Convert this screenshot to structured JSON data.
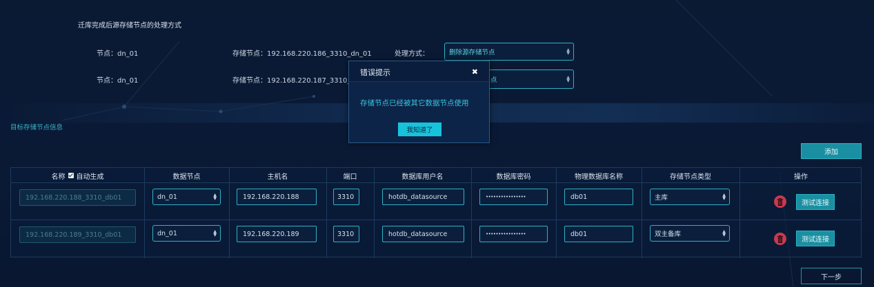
{
  "section_title": "迁库完成后源存储节点的处理方式",
  "process_rows": [
    {
      "node": "节点：dn_01",
      "storage": "存储节点：192.168.220.186_3310_dn_01",
      "method_label": "处理方式：",
      "method_value": "删除源存储节点"
    },
    {
      "node": "节点：dn_01",
      "storage": "存储节点：192.168.220.187_3310_dn_0",
      "method_value": "点"
    }
  ],
  "target_title": "目标存储节点信息",
  "add_button": "添加",
  "table": {
    "headers": {
      "name": "名称",
      "auto_generate": "自动生成",
      "data_node": "数据节点",
      "host": "主机名",
      "port": "端口",
      "db_user": "数据库用户名",
      "db_password": "数据库密码",
      "physical_db": "物理数据库名称",
      "node_type": "存储节点类型",
      "actions": "操作"
    },
    "rows": [
      {
        "name": "192.168.220.188_3310_db01",
        "data_node": "dn_01",
        "host": "192.168.220.188",
        "port": "3310",
        "db_user": "hotdb_datasource",
        "db_password": "••••••••••••••••",
        "physical_db": "db01",
        "node_type": "主库",
        "test_button": "测试连接"
      },
      {
        "name": "192.168.220.189_3310_db01",
        "data_node": "dn_01",
        "host": "192.168.220.189",
        "port": "3310",
        "db_user": "hotdb_datasource",
        "db_password": "••••••••••••••••",
        "physical_db": "db01",
        "node_type": "双主备库",
        "test_button": "测试连接"
      }
    ]
  },
  "modal": {
    "title": "错误提示",
    "close_glyph": "✖",
    "message": "存储节点已经被其它数据节点使用",
    "confirm": "我知道了"
  },
  "next_button": "下一步",
  "colors": {
    "accent": "#17c3dc",
    "teal_button": "#1b8fa2",
    "delete": "#c8394f",
    "background": "#0a1a36"
  }
}
